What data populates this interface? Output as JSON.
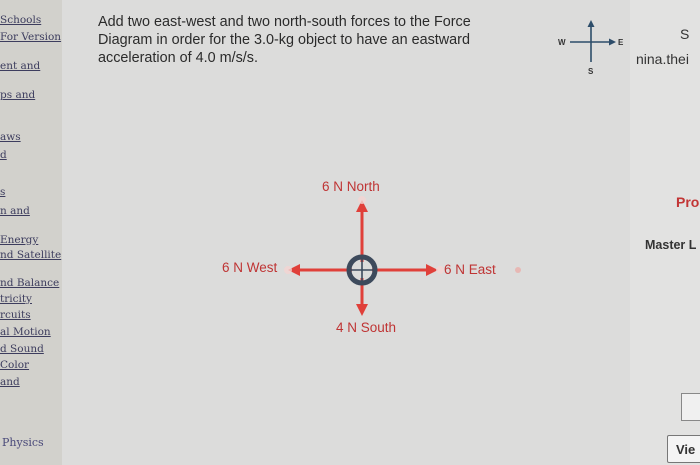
{
  "sidebar": {
    "links": [
      {
        "label": "Schools",
        "top": 0
      },
      {
        "label": "For Version",
        "top": 0
      },
      {
        "label": "ent and",
        "top": 0
      },
      {
        "label": "ps and",
        "top": 0
      },
      {
        "label": "aws",
        "top": 0
      },
      {
        "label": "d",
        "top": 0
      },
      {
        "label": "s",
        "top": 0
      },
      {
        "label": "n and",
        "top": 0
      },
      {
        "label": "Energy",
        "top": 0
      },
      {
        "label": "nd Satellite",
        "top": 0
      },
      {
        "label": "nd Balance",
        "top": 0
      },
      {
        "label": "tricity",
        "top": 0
      },
      {
        "label": "rcuits",
        "top": 0
      },
      {
        "label": "al Motion",
        "top": 0
      },
      {
        "label": "d Sound",
        "top": 0
      },
      {
        "label": "Color",
        "top": 0
      },
      {
        "label": "and",
        "top": 0
      }
    ],
    "footer": "Physics"
  },
  "question": {
    "text": "Add two east-west and two north-south forces to the Force Diagram in order for the 3.0-kg object to have an eastward acceleration of 4.0 m/s/s."
  },
  "compass": {
    "west": "W",
    "east": "E",
    "south": "S"
  },
  "diagram": {
    "north": "6 N North",
    "west": "6 N West",
    "east": "6 N East",
    "south": "4 N South",
    "arrow_color": "#e0403a",
    "object_color": "#3d4a5c"
  },
  "right_panel": {
    "s": "S",
    "user": "nina.thei",
    "pro": "Pro",
    "master": "Master L",
    "view_button": "Vie"
  }
}
